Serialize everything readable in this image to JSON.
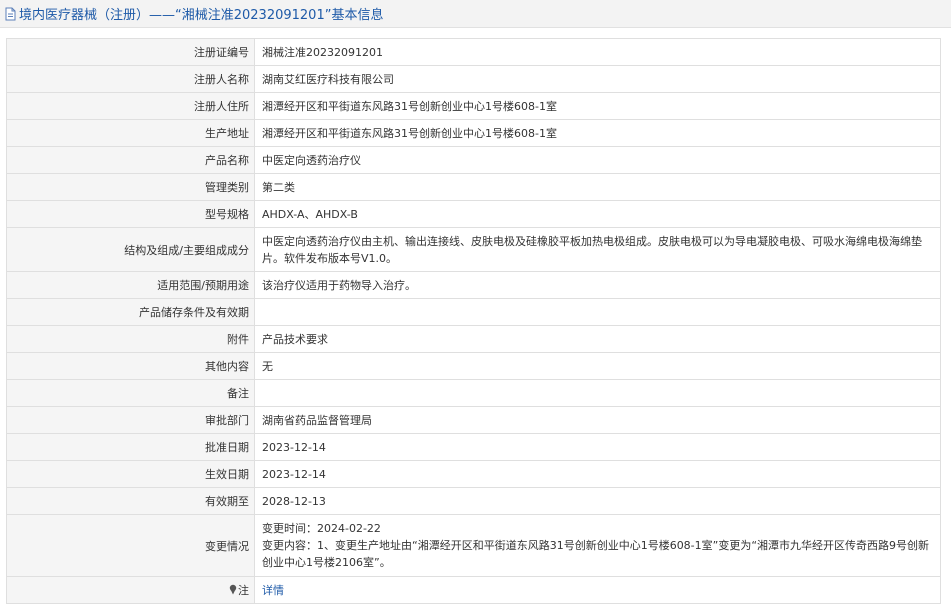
{
  "header": {
    "title": "境内医疗器械（注册）——“湘械注准20232091201”基本信息"
  },
  "rows": [
    {
      "label": "注册证编号",
      "value": "湘械注准20232091201"
    },
    {
      "label": "注册人名称",
      "value": "湖南艾红医疗科技有限公司"
    },
    {
      "label": "注册人住所",
      "value": "湘潭经开区和平街道东风路31号创新创业中心1号楼608-1室"
    },
    {
      "label": "生产地址",
      "value": "湘潭经开区和平街道东风路31号创新创业中心1号楼608-1室"
    },
    {
      "label": "产品名称",
      "value": "中医定向透药治疗仪"
    },
    {
      "label": "管理类别",
      "value": "第二类"
    },
    {
      "label": "型号规格",
      "value": "AHDX-A、AHDX-B"
    },
    {
      "label": "结构及组成/主要组成成分",
      "value": "中医定向透药治疗仪由主机、输出连接线、皮肤电极及硅橡胶平板加热电极组成。皮肤电极可以为导电凝胶电极、可吸水海绵电极海绵垫片。软件发布版本号V1.0。"
    },
    {
      "label": "适用范围/预期用途",
      "value": "该治疗仪适用于药物导入治疗。"
    },
    {
      "label": "产品储存条件及有效期",
      "value": ""
    },
    {
      "label": "附件",
      "value": "产品技术要求"
    },
    {
      "label": "其他内容",
      "value": "无"
    },
    {
      "label": "备注",
      "value": ""
    },
    {
      "label": "审批部门",
      "value": "湖南省药品监督管理局"
    },
    {
      "label": "批准日期",
      "value": "2023-12-14"
    },
    {
      "label": "生效日期",
      "value": "2023-12-14"
    },
    {
      "label": "有效期至",
      "value": "2028-12-13"
    }
  ],
  "change": {
    "label": "变更情况",
    "time": "变更时间：2024-02-22",
    "content": "变更内容：1、变更生产地址由“湘潭经开区和平街道东风路31号创新创业中心1号楼608-1室”变更为“湘潭市九华经开区传奇西路9号创新创业中心1号楼2106室”。"
  },
  "note": {
    "label": "注",
    "link": "详情"
  }
}
